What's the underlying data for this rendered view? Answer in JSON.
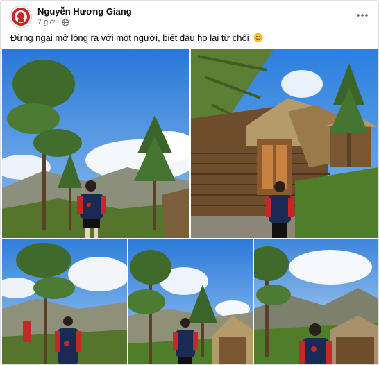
{
  "post": {
    "author": "Nguyễn Hương Giang",
    "time": "7 giờ ·",
    "privacy_icon": "globe-icon",
    "more_icon": "more-horizontal-icon",
    "caption": "Đừng ngại mở lòng ra với một người, biết đâu họ lại từ chối",
    "caption_emoji": "smiling-face-icon"
  },
  "photos": [
    {
      "id": "photo-1",
      "scene": "pine-tree-mountain"
    },
    {
      "id": "photo-2",
      "scene": "log-cabin"
    },
    {
      "id": "photo-3",
      "scene": "pine-tree-mountain"
    },
    {
      "id": "photo-4",
      "scene": "pine-tree-hut"
    },
    {
      "id": "photo-5",
      "scene": "mountain-hut"
    }
  ],
  "colors": {
    "sky": "#3d8be0",
    "grass": "#4f7d2a",
    "jacket": "#1b2a55",
    "text_secondary": "#65676b"
  }
}
